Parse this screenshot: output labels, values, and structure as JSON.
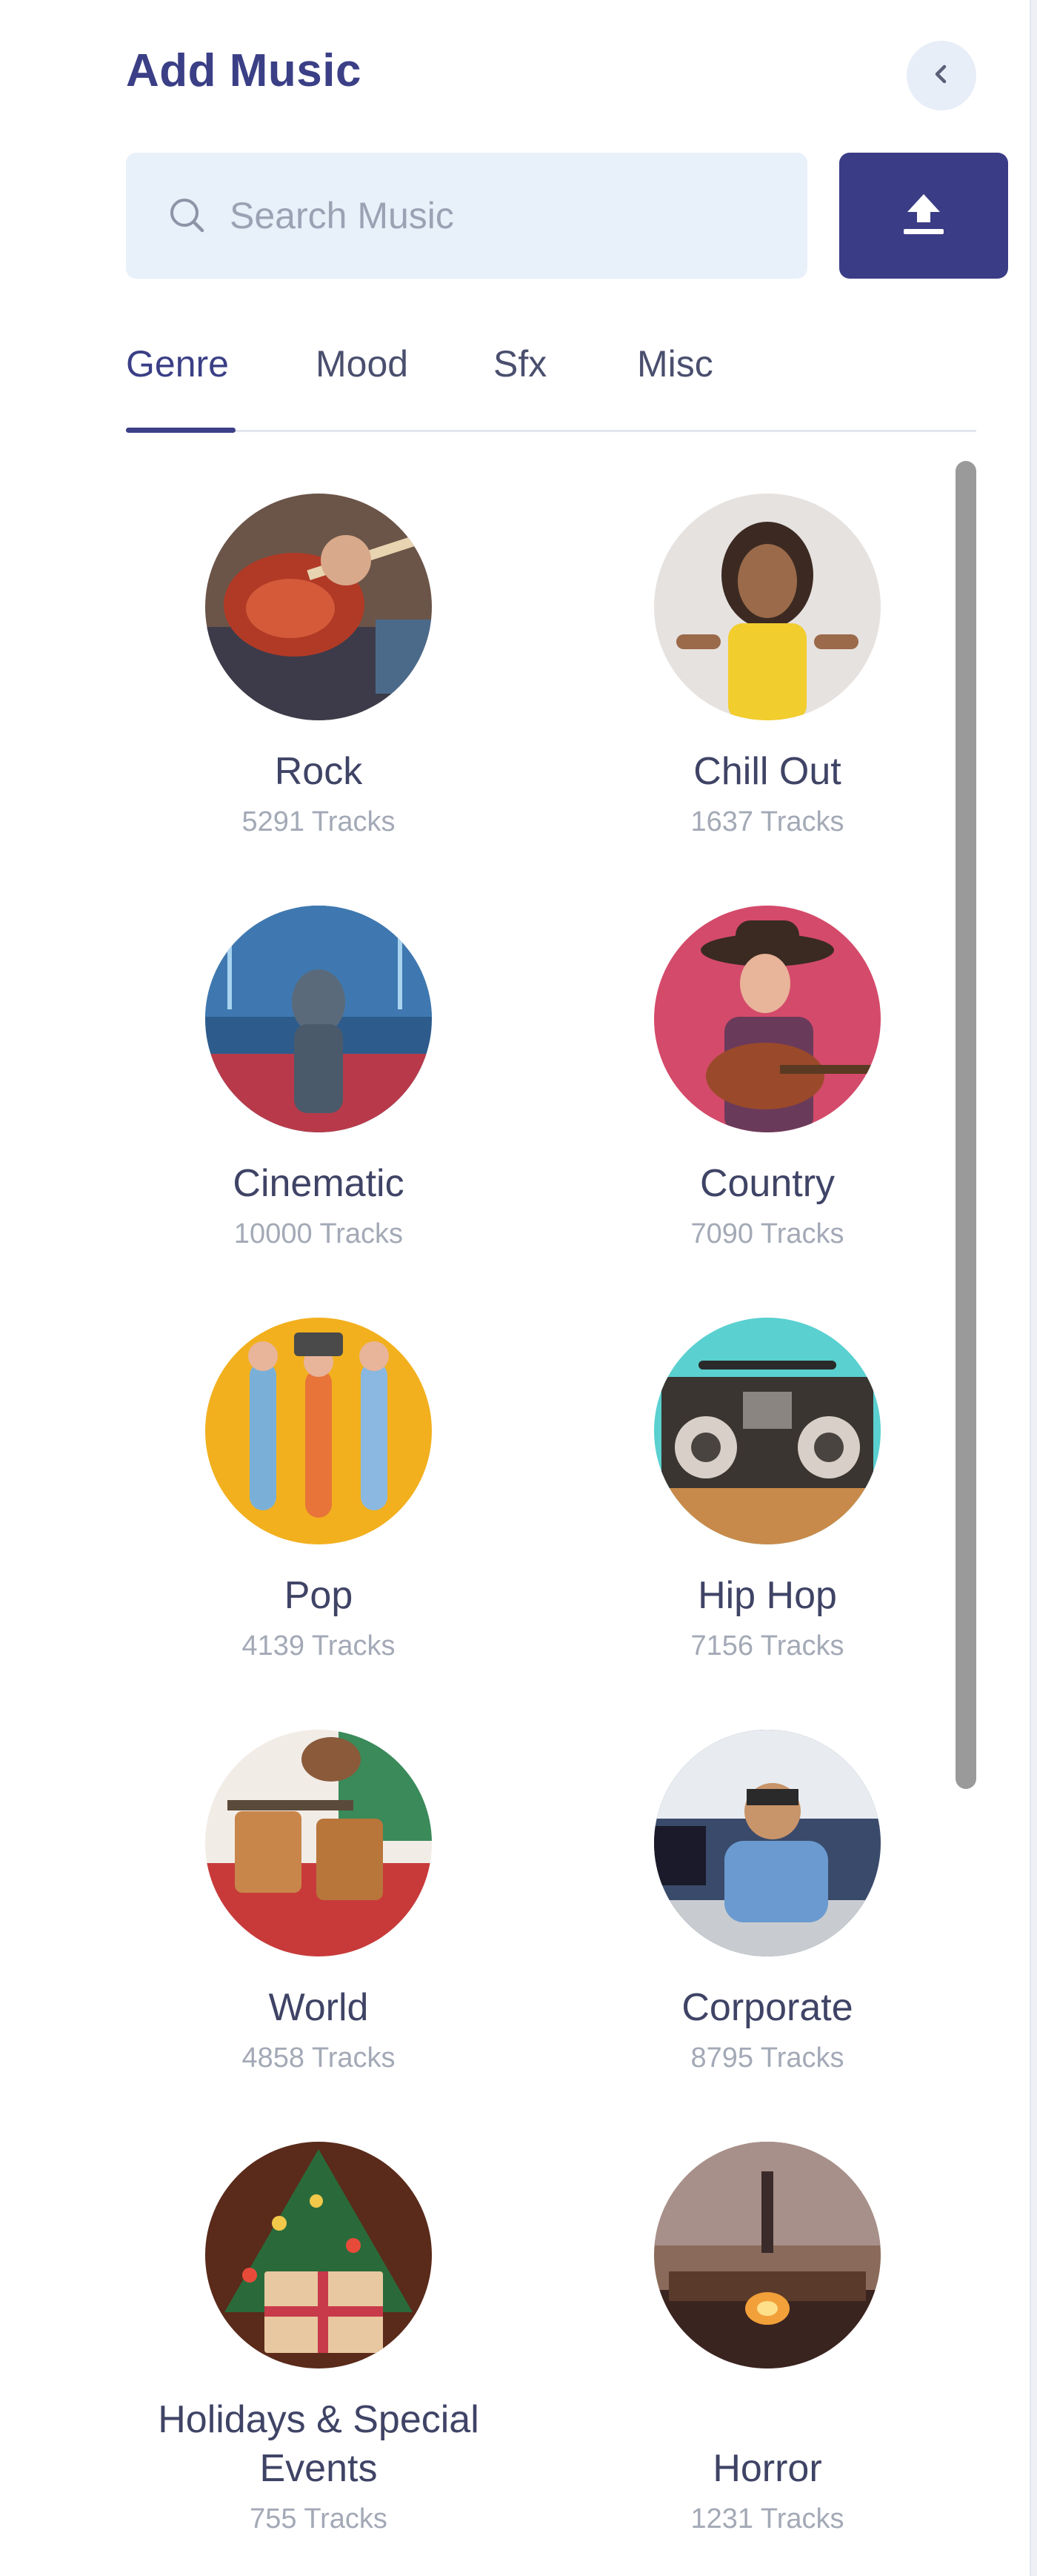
{
  "header": {
    "title": "Add Music"
  },
  "search": {
    "placeholder": "Search Music"
  },
  "tabs": [
    {
      "label": "Genre",
      "active": true
    },
    {
      "label": "Mood",
      "active": false
    },
    {
      "label": "Sfx",
      "active": false
    },
    {
      "label": "Misc",
      "active": false
    }
  ],
  "genres": [
    {
      "name": "Rock",
      "count": "5291 Tracks"
    },
    {
      "name": "Chill Out",
      "count": "1637 Tracks"
    },
    {
      "name": "Cinematic",
      "count": "10000 Tracks"
    },
    {
      "name": "Country",
      "count": "7090 Tracks"
    },
    {
      "name": "Pop",
      "count": "4139 Tracks"
    },
    {
      "name": "Hip Hop",
      "count": "7156 Tracks"
    },
    {
      "name": "World",
      "count": "4858 Tracks"
    },
    {
      "name": "Corporate",
      "count": "8795 Tracks"
    },
    {
      "name": "Holidays & Special Events",
      "count": "755 Tracks"
    },
    {
      "name": "Horror",
      "count": "1231 Tracks"
    }
  ],
  "colors": {
    "accent": "#3a3d85",
    "title": "#3a3f86",
    "search_bg": "#e8f0fa"
  },
  "icons": {
    "collapse": "chevron-left-icon",
    "search": "search-icon",
    "upload": "upload-icon"
  }
}
